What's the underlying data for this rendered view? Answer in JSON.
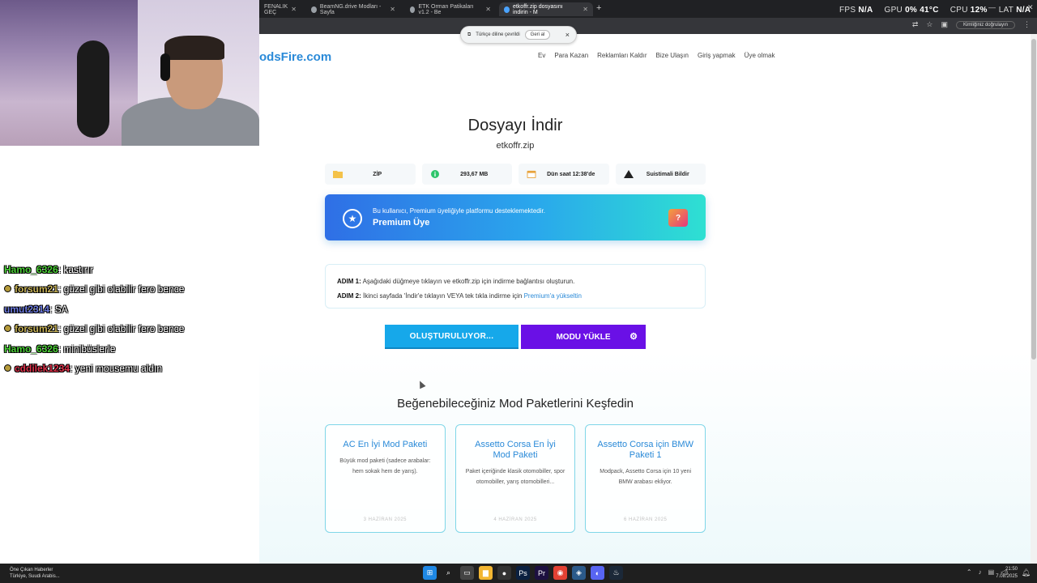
{
  "browser": {
    "tabs": [
      {
        "label": "FENALIK GEÇ",
        "active": false
      },
      {
        "label": "BeamNG.drive Modları - Sayfa",
        "active": false
      },
      {
        "label": "ETK Orman Patikaları v1.2 - Be",
        "active": false
      },
      {
        "label": "etkoffr.zip dosyasını indirin - M",
        "active": true
      }
    ],
    "new_tab": "+",
    "profile_label": "Kimliğiniz doğrulayın",
    "translate": {
      "label": "Türkçe diline çevrildi",
      "undo": "Geri al",
      "close": "×"
    }
  },
  "overlay_stats": [
    {
      "key": "FPS",
      "value": "N/A"
    },
    {
      "key": "GPU",
      "value": "0% 41°C"
    },
    {
      "key": "CPU",
      "value": "12%"
    },
    {
      "key": "LAT",
      "value": "N/A"
    }
  ],
  "site": {
    "logo": "odsFire.com",
    "nav": [
      "Ev",
      "Para Kazan",
      "Reklamları Kaldır",
      "Bize Ulaşın",
      "Giriş yapmak",
      "Üye olmak"
    ]
  },
  "download": {
    "title": "Dosyayı İndir",
    "filename": "etkoffr.zip",
    "chips": [
      {
        "icon": "folder-icon",
        "text": "ZİP"
      },
      {
        "icon": "info-icon",
        "text": "293,67 MB"
      },
      {
        "icon": "calendar-icon",
        "text": "Dün saat 12:38'de"
      },
      {
        "icon": "warning-icon",
        "text": "Suistimali Bildir"
      }
    ],
    "premium": {
      "subtitle": "Bu kullanıcı, Premium üyeliğiyle platformu desteklemektedir.",
      "title": "Premium Üye",
      "help": "?"
    },
    "steps": {
      "step1_label": "ADIM 1:",
      "step1_text": "Aşağıdaki düğmeye tıklayın ve etkoffr.zip için indirme bağlantısı oluşturun.",
      "step2_label": "ADIM 2:",
      "step2_text": "İkinci sayfada 'İndir'e tıklayın VEYA tek tıkla indirme için",
      "step2_link": "Premium'a yükseltin"
    },
    "generate_button": "OLUŞTURULUYOR...",
    "upload_button": "MODU YÜKLE"
  },
  "recommendations": {
    "title": "Beğenebileceğiniz Mod Paketlerini Keşfedin",
    "cards": [
      {
        "title": "AC En İyi Mod Paketi",
        "desc": "Büyük mod paketi (sadece arabalar: hem sokak hem de yarış).",
        "date": "3 HAZİRAN 2025"
      },
      {
        "title": "Assetto Corsa En İyi Mod Paketi",
        "desc": "Paket içeriğinde klasik otomobiller, spor otomobiller, yarış otomobilleri...",
        "date": "4 HAZİRAN 2025"
      },
      {
        "title": "Assetto Corsa için BMW Paketi 1",
        "desc": "Modpack, Assetto Corsa için 10 yeni BMW arabası ekliyor.",
        "date": "6 HAZİRAN 2025"
      }
    ]
  },
  "chat": [
    {
      "user": "Hamo_6326",
      "color": "#4cd137",
      "badge": false,
      "msg": ": kastırır"
    },
    {
      "user": "forsum21",
      "color": "#c9b458",
      "badge": true,
      "msg": ": güzel gibi olabilir fero bence"
    },
    {
      "user": "umut2314",
      "color": "#6c7ae0",
      "badge": false,
      "msg": ": SA"
    },
    {
      "user": "forsum21",
      "color": "#c9b458",
      "badge": true,
      "msg": ": güzel gibi olabilir fero bence"
    },
    {
      "user": "Hamo_6326",
      "color": "#4cd137",
      "badge": false,
      "msg": ": minibüslerle"
    },
    {
      "user": "cddilek1234",
      "color": "#e0324b",
      "badge": true,
      "msg": ": yeni mousemu aldın"
    }
  ],
  "taskbar": {
    "news_title": "Öne Çıkan Haberler",
    "news_sub": "Türkiye, Suudi Arabis...",
    "time": "21:50",
    "date": "7.08.2025"
  }
}
